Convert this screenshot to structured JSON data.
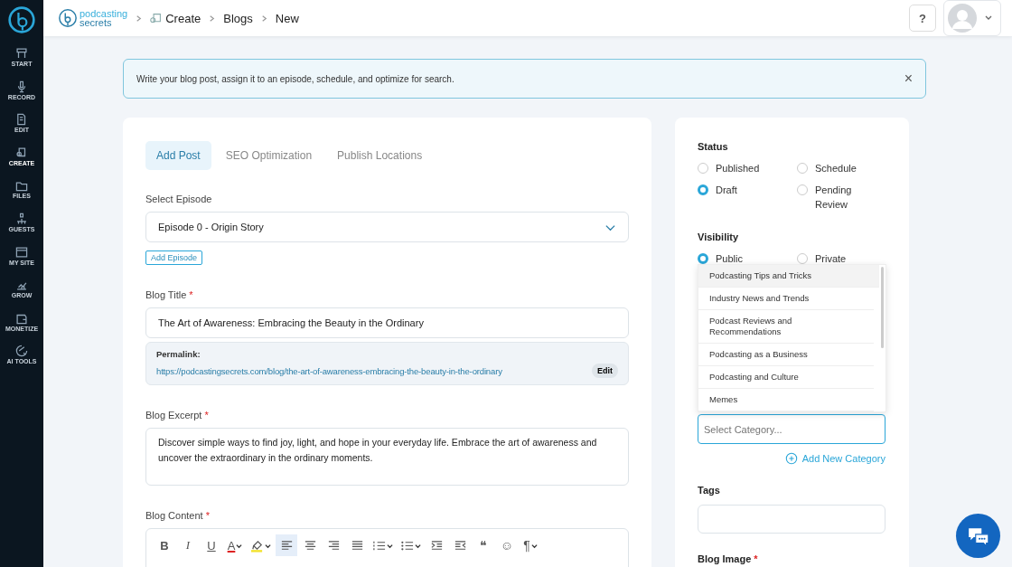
{
  "sidebar": {
    "items": [
      {
        "label": "START",
        "selected": false
      },
      {
        "label": "RECORD",
        "selected": false
      },
      {
        "label": "EDIT",
        "selected": false
      },
      {
        "label": "CREATE",
        "selected": true
      },
      {
        "label": "FILES",
        "selected": false
      },
      {
        "label": "GUESTS",
        "selected": false
      },
      {
        "label": "MY SITE",
        "selected": false
      },
      {
        "label": "GROW",
        "selected": false
      },
      {
        "label": "MONETIZE",
        "selected": false
      },
      {
        "label": "AI TOOLS",
        "selected": false
      }
    ]
  },
  "header": {
    "logo_top": "podcasting",
    "logo_bottom": "secrets",
    "breadcrumbs": [
      "Create",
      "Blogs",
      "New"
    ],
    "help": "?"
  },
  "notice": {
    "text": "Write your blog post, assign it to an episode, schedule, and optimize for search.",
    "close": "×"
  },
  "tabs": [
    {
      "label": "Add Post",
      "selected": true
    },
    {
      "label": "SEO Optimization",
      "selected": false
    },
    {
      "label": "Publish Locations",
      "selected": false
    }
  ],
  "episode": {
    "label": "Select Episode",
    "value": "Episode 0 - Origin Story",
    "add_button": "Add Episode"
  },
  "title_field": {
    "label": "Blog Title",
    "required_mark": "*",
    "value": "The Art of Awareness: Embracing the Beauty in the Ordinary"
  },
  "permalink": {
    "label": "Permalink:",
    "url": "https://podcastingsecrets.com/blog/the-art-of-awareness-embracing-the-beauty-in-the-ordinary",
    "edit": "Edit"
  },
  "excerpt": {
    "label": "Blog Excerpt",
    "required_mark": "*",
    "value": "Discover simple ways to find joy, light, and hope in your everyday life. Embrace the art of awareness and uncover the extraordinary in the ordinary moments."
  },
  "content": {
    "label": "Blog Content",
    "required_mark": "*",
    "toolbar": [
      {
        "kind": "bold",
        "label": "B",
        "selected": false
      },
      {
        "kind": "italic",
        "label": "I",
        "selected": false
      },
      {
        "kind": "underline",
        "label": "U",
        "selected": false
      },
      {
        "kind": "text-color",
        "label": "A",
        "selected": false
      },
      {
        "kind": "highlight",
        "selected": false
      },
      {
        "kind": "align-left",
        "selected": true
      },
      {
        "kind": "align-center",
        "selected": false
      },
      {
        "kind": "align-right",
        "selected": false
      },
      {
        "kind": "justify",
        "selected": false
      },
      {
        "kind": "ordered-list",
        "selected": false
      },
      {
        "kind": "bullet-list",
        "selected": false
      },
      {
        "kind": "indent",
        "selected": false
      },
      {
        "kind": "outdent",
        "selected": false
      },
      {
        "kind": "quote",
        "label": "❝",
        "selected": false
      },
      {
        "kind": "emoji",
        "label": "☺",
        "selected": false
      },
      {
        "kind": "paragraph",
        "label": "¶",
        "selected": false
      }
    ]
  },
  "status": {
    "label": "Status",
    "options": [
      {
        "label": "Published",
        "selected": false
      },
      {
        "label": "Schedule",
        "selected": false
      },
      {
        "label": "Draft",
        "selected": true
      },
      {
        "label": "Pending Review",
        "selected": false
      }
    ]
  },
  "visibility": {
    "label": "Visibility",
    "options": [
      {
        "label": "Public",
        "selected": true
      },
      {
        "label": "Private",
        "selected": false
      }
    ]
  },
  "category": {
    "options": [
      {
        "label": "Podcasting Tips and Tricks",
        "selected": true
      },
      {
        "label": "Industry News and Trends",
        "selected": false
      },
      {
        "label": "Podcast Reviews and Recommendations",
        "selected": false
      },
      {
        "label": "Podcasting as a Business",
        "selected": false
      },
      {
        "label": "Podcasting and Culture",
        "selected": false
      },
      {
        "label": "Memes",
        "selected": false
      }
    ],
    "placeholder": "Select Category...",
    "add": "Add New Category"
  },
  "tags": {
    "label": "Tags"
  },
  "blog_image": {
    "label": "Blog Image",
    "required_mark": "*"
  }
}
